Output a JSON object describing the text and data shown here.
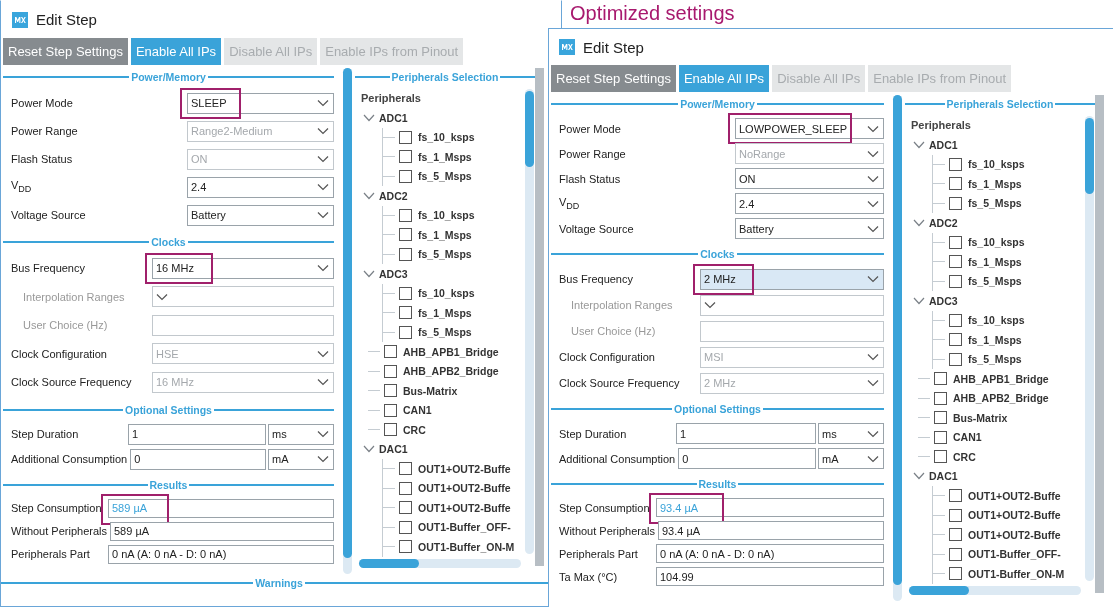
{
  "annotation": "Optimized settings",
  "dialogs": [
    {
      "title": "Edit Step",
      "buttons": [
        {
          "label": "Reset Step Settings",
          "kind": "reset"
        },
        {
          "label": "Enable All IPs",
          "kind": "primary"
        },
        {
          "label": "Disable All IPs",
          "kind": "disabled"
        },
        {
          "label": "Enable IPs from Pinout",
          "kind": "disabled"
        }
      ],
      "sections": [
        {
          "title": "Power/Memory",
          "rows": [
            {
              "label": "Power Mode",
              "kind": "select",
              "value": "SLEEP",
              "disabled": false,
              "highlighted": true,
              "focused": false
            },
            {
              "label": "Power Range",
              "kind": "select",
              "value": "Range2-Medium",
              "disabled": true,
              "highlighted": false,
              "focused": false
            },
            {
              "label": "Flash Status",
              "kind": "select",
              "value": "ON",
              "disabled": true,
              "highlighted": false,
              "focused": false
            },
            {
              "label": "V$_{DD}$",
              "kind": "select",
              "value": "2.4",
              "disabled": false,
              "highlighted": false,
              "focused": false
            },
            {
              "label": "Voltage Source",
              "kind": "select",
              "value": "Battery",
              "disabled": false,
              "highlighted": false,
              "focused": false
            }
          ]
        },
        {
          "title": "Clocks",
          "rows": [
            {
              "label": "Bus Frequency",
              "kind": "select",
              "value": "16 MHz",
              "disabled": false,
              "highlighted": true,
              "focused": false,
              "children": [
                {
                  "label": "Interpolation Ranges",
                  "kind": "select",
                  "disabled": true,
                  "highlighted": false,
                  "focused": false
                },
                {
                  "label": "User Choice (Hz)",
                  "kind": "input",
                  "disabled": true,
                  "highlighted": false,
                  "focused": false
                }
              ]
            },
            {
              "label": "Clock Configuration",
              "kind": "select",
              "value": "HSE",
              "disabled": true,
              "highlighted": false,
              "focused": false
            },
            {
              "label": "Clock Source Frequency",
              "kind": "select",
              "value": "16 MHz",
              "disabled": true,
              "highlighted": false,
              "focused": false
            }
          ]
        },
        {
          "title": "Optional Settings",
          "rows": [
            {
              "label": "Step Duration",
              "kind": "input-unit",
              "value": "1",
              "unit": "ms",
              "disabled": false,
              "highlighted": false,
              "focused": false
            },
            {
              "label": "Additional Consumption",
              "kind": "input-unit",
              "value": "0",
              "unit": "mA",
              "disabled": false,
              "highlighted": false,
              "focused": false
            }
          ]
        },
        {
          "title": "Results",
          "rows": [
            {
              "label": "Step Consumption",
              "kind": "output",
              "value": "589 µA",
              "emphasis": true,
              "disabled": false,
              "highlighted": true,
              "focused": false
            },
            {
              "label": "Without Peripherals",
              "kind": "output",
              "value": "589 µA",
              "emphasis": false,
              "disabled": false,
              "highlighted": false,
              "focused": false
            },
            {
              "label": "Peripherals Part",
              "kind": "output",
              "value": "0 nA  (A: 0 nA - D: 0 nA)",
              "emphasis": false,
              "disabled": false,
              "highlighted": false,
              "focused": false
            }
          ]
        }
      ],
      "peripherals": {
        "title": "Peripherals Selection",
        "root": "Peripherals",
        "items": [
          {
            "label": "ADC1",
            "expanded": true,
            "children": [
              {
                "label": "fs_10_ksps",
                "checked": false
              },
              {
                "label": "fs_1_Msps",
                "checked": false
              },
              {
                "label": "fs_5_Msps",
                "checked": false
              }
            ]
          },
          {
            "label": "ADC2",
            "expanded": true,
            "children": [
              {
                "label": "fs_10_ksps",
                "checked": false
              },
              {
                "label": "fs_1_Msps",
                "checked": false
              },
              {
                "label": "fs_5_Msps",
                "checked": false
              }
            ]
          },
          {
            "label": "ADC3",
            "expanded": true,
            "children": [
              {
                "label": "fs_10_ksps",
                "checked": false
              },
              {
                "label": "fs_1_Msps",
                "checked": false
              },
              {
                "label": "fs_5_Msps",
                "checked": false
              }
            ]
          },
          {
            "label": "AHB_APB1_Bridge",
            "checked": false
          },
          {
            "label": "AHB_APB2_Bridge",
            "checked": false
          },
          {
            "label": "Bus-Matrix",
            "checked": false
          },
          {
            "label": "CAN1",
            "checked": false
          },
          {
            "label": "CRC",
            "checked": false
          },
          {
            "label": "DAC1",
            "expanded": true,
            "children": [
              {
                "label": "OUT1+OUT2-Buffe",
                "checked": false
              },
              {
                "label": "OUT1+OUT2-Buffe",
                "checked": false
              },
              {
                "label": "OUT1+OUT2-Buffe",
                "checked": false
              },
              {
                "label": "OUT1-Buffer_OFF-",
                "checked": false
              },
              {
                "label": "OUT1-Buffer_ON-M",
                "checked": false
              }
            ]
          }
        ]
      },
      "warnings": "Warnings"
    },
    {
      "title": "Edit Step",
      "buttons": [
        {
          "label": "Reset Step Settings",
          "kind": "reset"
        },
        {
          "label": "Enable All IPs",
          "kind": "primary"
        },
        {
          "label": "Disable All IPs",
          "kind": "disabled"
        },
        {
          "label": "Enable IPs from Pinout",
          "kind": "disabled"
        }
      ],
      "sections": [
        {
          "title": "Power/Memory",
          "rows": [
            {
              "label": "Power Mode",
              "kind": "select",
              "value": "LOWPOWER_SLEEP",
              "disabled": false,
              "highlighted": true,
              "focused": false
            },
            {
              "label": "Power Range",
              "kind": "select",
              "value": "NoRange",
              "disabled": true,
              "highlighted": false,
              "focused": false
            },
            {
              "label": "Flash Status",
              "kind": "select",
              "value": "ON",
              "disabled": false,
              "highlighted": false,
              "focused": false
            },
            {
              "label": "V$_{DD}$",
              "kind": "select",
              "value": "2.4",
              "disabled": false,
              "highlighted": false,
              "focused": false
            },
            {
              "label": "Voltage Source",
              "kind": "select",
              "value": "Battery",
              "disabled": false,
              "highlighted": false,
              "focused": false
            }
          ]
        },
        {
          "title": "Clocks",
          "rows": [
            {
              "label": "Bus Frequency",
              "kind": "select",
              "value": "2 MHz",
              "disabled": false,
              "highlighted": true,
              "focused": true,
              "children": [
                {
                  "label": "Interpolation Ranges",
                  "kind": "select",
                  "disabled": true,
                  "highlighted": false,
                  "focused": false
                },
                {
                  "label": "User Choice (Hz)",
                  "kind": "input",
                  "disabled": true,
                  "highlighted": false,
                  "focused": false
                }
              ]
            },
            {
              "label": "Clock Configuration",
              "kind": "select",
              "value": "MSI",
              "disabled": true,
              "highlighted": false,
              "focused": false
            },
            {
              "label": "Clock Source Frequency",
              "kind": "select",
              "value": "2 MHz",
              "disabled": true,
              "highlighted": false,
              "focused": false
            }
          ]
        },
        {
          "title": "Optional Settings",
          "rows": [
            {
              "label": "Step Duration",
              "kind": "input-unit",
              "value": "1",
              "unit": "ms",
              "disabled": false,
              "highlighted": false,
              "focused": false
            },
            {
              "label": "Additional Consumption",
              "kind": "input-unit",
              "value": "0",
              "unit": "mA",
              "disabled": false,
              "highlighted": false,
              "focused": false
            }
          ]
        },
        {
          "title": "Results",
          "rows": [
            {
              "label": "Step Consumption",
              "kind": "output",
              "value": "93.4 µA",
              "emphasis": true,
              "disabled": false,
              "highlighted": true,
              "focused": false
            },
            {
              "label": "Without Peripherals",
              "kind": "output",
              "value": "93.4 µA",
              "emphasis": false,
              "disabled": false,
              "highlighted": false,
              "focused": false
            },
            {
              "label": "Peripherals Part",
              "kind": "output",
              "value": "0 nA  (A: 0 nA - D: 0 nA)",
              "emphasis": false,
              "disabled": false,
              "highlighted": false,
              "focused": false
            },
            {
              "label": "Ta Max (°C)",
              "kind": "output",
              "value": "104.99",
              "emphasis": false,
              "disabled": false,
              "highlighted": false,
              "focused": false
            }
          ]
        }
      ],
      "peripherals": {
        "title": "Peripherals Selection",
        "root": "Peripherals",
        "items": [
          {
            "label": "ADC1",
            "expanded": true,
            "children": [
              {
                "label": "fs_10_ksps",
                "checked": false
              },
              {
                "label": "fs_1_Msps",
                "checked": false
              },
              {
                "label": "fs_5_Msps",
                "checked": false
              }
            ]
          },
          {
            "label": "ADC2",
            "expanded": true,
            "children": [
              {
                "label": "fs_10_ksps",
                "checked": false
              },
              {
                "label": "fs_1_Msps",
                "checked": false
              },
              {
                "label": "fs_5_Msps",
                "checked": false
              }
            ]
          },
          {
            "label": "ADC3",
            "expanded": true,
            "children": [
              {
                "label": "fs_10_ksps",
                "checked": false
              },
              {
                "label": "fs_1_Msps",
                "checked": false
              },
              {
                "label": "fs_5_Msps",
                "checked": false
              }
            ]
          },
          {
            "label": "AHB_APB1_Bridge",
            "checked": false
          },
          {
            "label": "AHB_APB2_Bridge",
            "checked": false
          },
          {
            "label": "Bus-Matrix",
            "checked": false
          },
          {
            "label": "CAN1",
            "checked": false
          },
          {
            "label": "CRC",
            "checked": false
          },
          {
            "label": "DAC1",
            "expanded": true,
            "children": [
              {
                "label": "OUT1+OUT2-Buffe",
                "checked": false
              },
              {
                "label": "OUT1+OUT2-Buffe",
                "checked": false
              },
              {
                "label": "OUT1+OUT2-Buffe",
                "checked": false
              },
              {
                "label": "OUT1-Buffer_OFF-",
                "checked": false
              },
              {
                "label": "OUT1-Buffer_ON-M",
                "checked": false
              }
            ]
          }
        ]
      }
    }
  ]
}
